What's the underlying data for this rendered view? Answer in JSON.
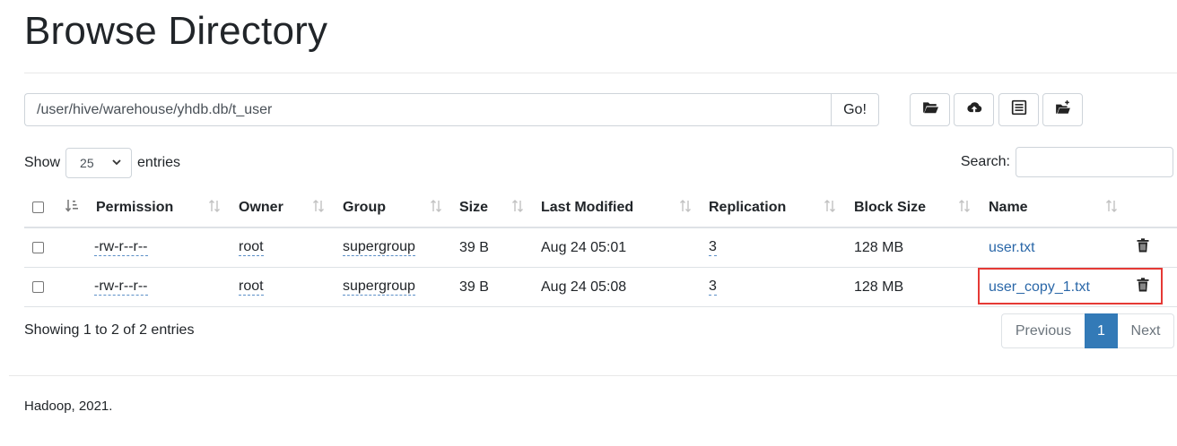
{
  "page": {
    "title": "Browse Directory",
    "footer": "Hadoop, 2021."
  },
  "path_bar": {
    "value": "/user/hive/warehouse/yhdb.db/t_user",
    "go_label": "Go!"
  },
  "toolbar": [
    "folder-open-icon",
    "cloud-upload-icon",
    "list-alt-icon",
    "folder-plus-icon"
  ],
  "entries": {
    "show_label": "Show",
    "value": "25",
    "suffix": "entries"
  },
  "search": {
    "label": "Search:",
    "value": ""
  },
  "table": {
    "columns": [
      "Permission",
      "Owner",
      "Group",
      "Size",
      "Last Modified",
      "Replication",
      "Block Size",
      "Name"
    ],
    "rows": [
      {
        "permission": "-rw-r--r--",
        "owner": "root",
        "group": "supergroup",
        "size": "39 B",
        "modified": "Aug 24 05:01",
        "replication": "3",
        "block_size": "128 MB",
        "name": "user.txt"
      },
      {
        "permission": "-rw-r--r--",
        "owner": "root",
        "group": "supergroup",
        "size": "39 B",
        "modified": "Aug 24 05:08",
        "replication": "3",
        "block_size": "128 MB",
        "name": "user_copy_1.txt"
      }
    ]
  },
  "info": "Showing 1 to 2 of 2 entries",
  "pagination": {
    "previous": "Previous",
    "current": "1",
    "next": "Next"
  },
  "colors": {
    "link": "#2a67a8",
    "active_page": "#337ab7",
    "highlight_box": "#e53935"
  }
}
